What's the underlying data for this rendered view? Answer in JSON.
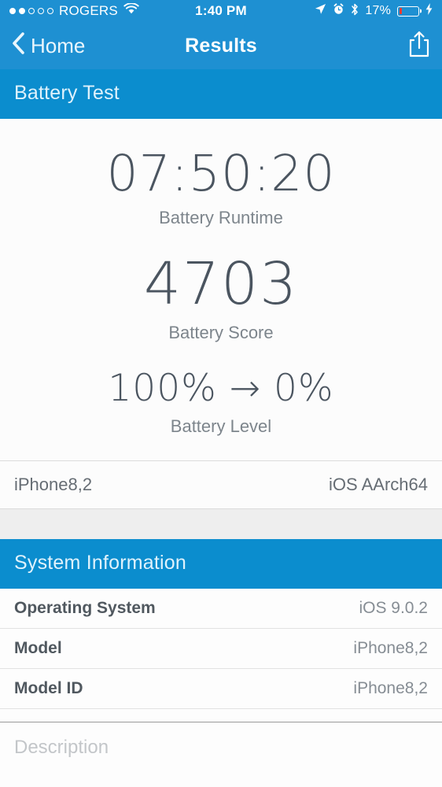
{
  "status_bar": {
    "carrier": "ROGERS",
    "signal_bars_filled": 2,
    "signal_bars_total": 5,
    "wifi_icon": "wifi-icon",
    "time": "1:40 PM",
    "location_icon": "location-arrow-icon",
    "alarm_icon": "alarm-clock-icon",
    "bluetooth_icon": "bluetooth-icon",
    "battery_percent": "17%",
    "battery_level_value": 17,
    "battery_color": "#ee3b30",
    "charging_icon": "lightning-bolt-icon"
  },
  "nav_bar": {
    "back_icon": "chevron-left-icon",
    "back_label": "Home",
    "title": "Results",
    "share_icon": "share-icon",
    "background_color": "#1e90d2"
  },
  "battery_test_section": {
    "header": "Battery Test",
    "header_color": "#0b8dce",
    "metrics": [
      {
        "value": "07:50:20",
        "label": "Battery Runtime"
      },
      {
        "value": "4703",
        "label": "Battery Score"
      },
      {
        "value": "100% → 0%",
        "label": "Battery Level"
      }
    ],
    "device_row": {
      "model": "iPhone8,2",
      "platform": "iOS AArch64"
    }
  },
  "system_information_section": {
    "header": "System Information",
    "header_color": "#0b8dce",
    "rows": [
      {
        "label": "Operating System",
        "value": "iOS 9.0.2"
      },
      {
        "label": "Model",
        "value": "iPhone8,2"
      },
      {
        "label": "Model ID",
        "value": "iPhone8,2"
      }
    ]
  },
  "description_field": {
    "placeholder": "Description",
    "value": ""
  }
}
